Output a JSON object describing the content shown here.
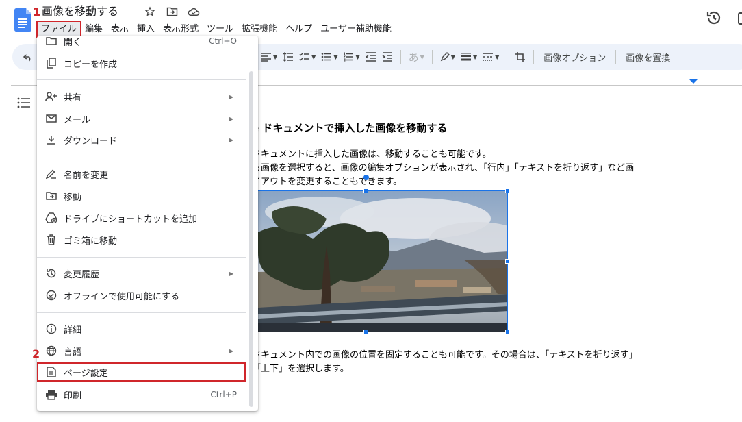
{
  "header": {
    "title": "画像を移動する",
    "menus": [
      "ファイル",
      "編集",
      "表示",
      "挿入",
      "表示形式",
      "ツール",
      "拡張機能",
      "ヘルプ",
      "ユーザー補助機能"
    ],
    "active_menu_index": 0
  },
  "toolbar": {
    "image_options": "画像オプション",
    "replace_image": "画像を置換",
    "text_color_glyph": "あ"
  },
  "document": {
    "heading": "e ドキュメントで挿入した画像を移動する",
    "para1_line1": "ドキュメントに挿入した画像は、移動することも可能です。",
    "para1_line2": "る画像を選択すると、画像の編集オプションが表示され、「行内」「テキストを折り返す」など画",
    "para1_line3": "イアウトを変更することもできます。",
    "para2_line1": "ドキュメント内での画像の位置を固定することも可能です。その場合は、「テキストを折り返す」",
    "para2_line2": "「上下」を選択します。"
  },
  "file_menu": {
    "open": {
      "label": "開く",
      "shortcut": "Ctrl+O"
    },
    "make_copy": {
      "label": "コピーを作成"
    },
    "share": {
      "label": "共有"
    },
    "email": {
      "label": "メール"
    },
    "download": {
      "label": "ダウンロード"
    },
    "rename": {
      "label": "名前を変更"
    },
    "move": {
      "label": "移動"
    },
    "add_shortcut": {
      "label": "ドライブにショートカットを追加"
    },
    "trash": {
      "label": "ゴミ箱に移動"
    },
    "version_history": {
      "label": "変更履歴"
    },
    "offline": {
      "label": "オフラインで使用可能にする"
    },
    "details": {
      "label": "詳細"
    },
    "language": {
      "label": "言語"
    },
    "page_setup": {
      "label": "ページ設定"
    },
    "print": {
      "label": "印刷",
      "shortcut": "Ctrl+P"
    }
  },
  "annotations": {
    "step1": "1",
    "step2": "2"
  },
  "colors": {
    "accent": "#1a73e8",
    "highlight_red": "#d0262b",
    "toolbar_bg": "#edf2fa"
  }
}
